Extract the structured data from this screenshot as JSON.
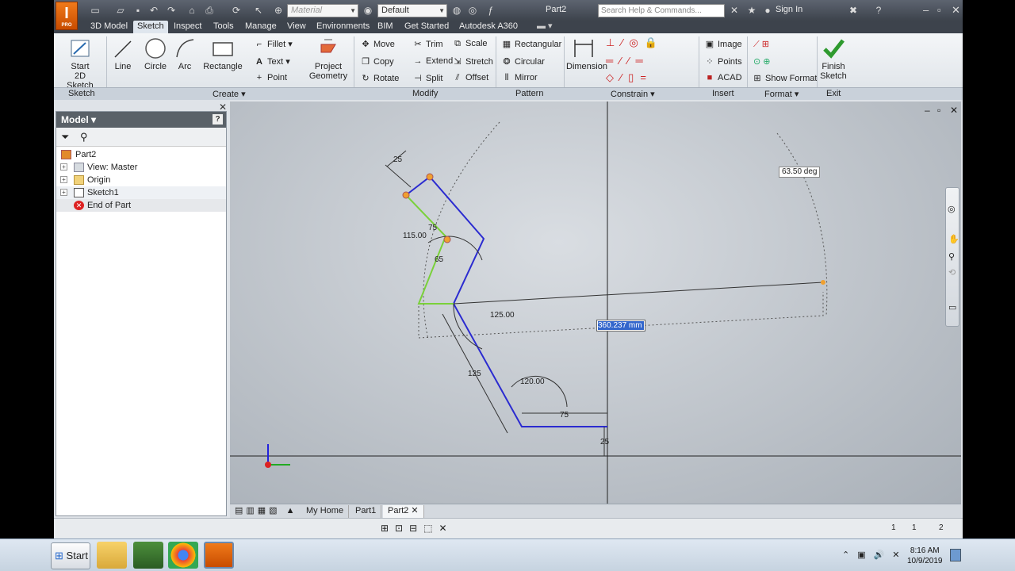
{
  "app": {
    "title": "Part2",
    "logo_letter": "I",
    "logo_sub": "PRO",
    "material_placeholder": "Material",
    "appearance": "Default",
    "search_placeholder": "Search Help & Commands...",
    "sign_in": "Sign In"
  },
  "tabs": [
    "3D Model",
    "Sketch",
    "Inspect",
    "Tools",
    "Manage",
    "View",
    "Environments",
    "BIM",
    "Get Started",
    "Autodesk A360"
  ],
  "active_tab": "Sketch",
  "ribbon": {
    "sketch": {
      "start_label": "Start",
      "start_label2": "2D Sketch",
      "panel": "Sketch"
    },
    "create": {
      "line": "Line",
      "circle": "Circle",
      "arc": "Arc",
      "rectangle": "Rectangle",
      "fillet": "Fillet",
      "text": "Text",
      "point": "Point",
      "project_label": "Project",
      "project_label2": "Geometry",
      "panel": "Create"
    },
    "modify": {
      "move": "Move",
      "trim": "Trim",
      "scale": "Scale",
      "copy": "Copy",
      "extend": "Extend",
      "stretch": "Stretch",
      "rotate": "Rotate",
      "split": "Split",
      "offset": "Offset",
      "panel": "Modify"
    },
    "pattern": {
      "rectangular": "Rectangular",
      "circular": "Circular",
      "mirror": "Mirror",
      "panel": "Pattern"
    },
    "constrain": {
      "dimension": "Dimension",
      "panel": "Constrain"
    },
    "insert": {
      "image": "Image",
      "points": "Points",
      "acad": "ACAD",
      "panel": "Insert"
    },
    "format": {
      "show_format": "Show Format",
      "panel": "Format"
    },
    "exit": {
      "finish_label": "Finish",
      "finish_label2": "Sketch",
      "panel": "Exit"
    }
  },
  "browser": {
    "title": "Model",
    "items": [
      {
        "label": "Part2",
        "icon": "part-icon"
      },
      {
        "label": "View: Master",
        "icon": "view-icon"
      },
      {
        "label": "Origin",
        "icon": "folder-icon"
      },
      {
        "label": "Sketch1",
        "icon": "sketch-icon"
      },
      {
        "label": "End of Part",
        "icon": "end-of-part-icon"
      }
    ]
  },
  "sketch": {
    "dims": {
      "d25_top": "25",
      "d115": "115.00",
      "d75": "75",
      "d65": "65",
      "d125_angle": "125.00",
      "d125": "125",
      "d120": "120.00",
      "d75_bottom": "75",
      "d25_right": "25"
    },
    "angle_box": "63.50 deg",
    "length_input": "360.237 mm"
  },
  "doc_tabs": [
    "My Home",
    "Part1",
    "Part2"
  ],
  "active_doc": "Part2",
  "status": {
    "page_a": "1",
    "page_b": "1",
    "page_c": "2"
  },
  "taskbar": {
    "start": "Start",
    "time": "8:16 AM",
    "date": "10/9/2019"
  },
  "colors": {
    "accent": "#e8701a",
    "sketch_line": "#2b2bd0",
    "selected_line": "#7ad13a"
  }
}
